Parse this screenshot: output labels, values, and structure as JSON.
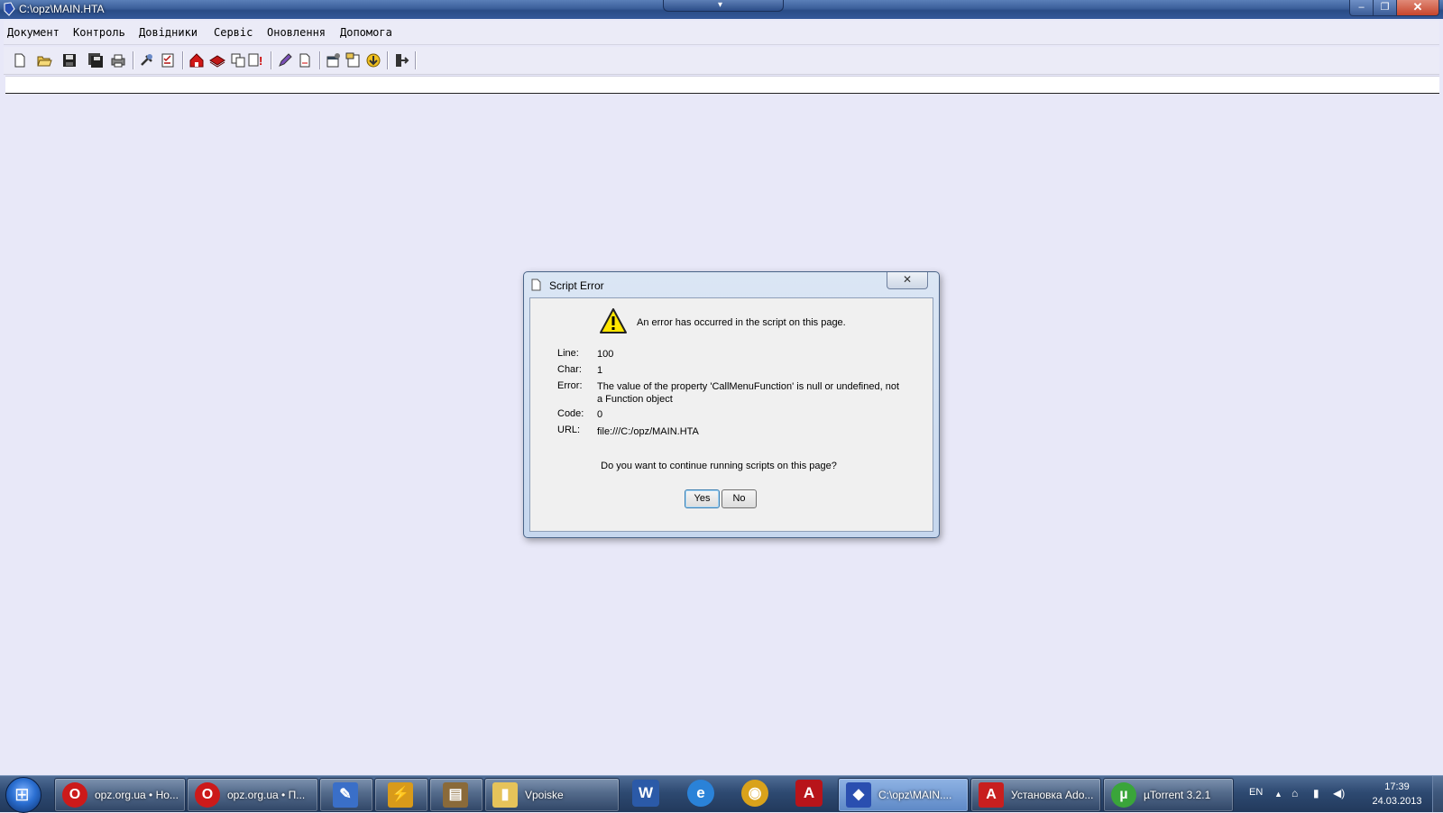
{
  "window": {
    "title": "C:\\opz\\MAIN.HTA",
    "min_label": "–",
    "max_label": "❐",
    "close_label": "✕",
    "collapse_label": "▾"
  },
  "menu": {
    "items": [
      "Документ",
      "Контроль",
      "Довідники",
      "Сервіс",
      "Оновлення",
      "Допомога"
    ]
  },
  "toolbar": {
    "icons": [
      "new-document-icon",
      "open-folder-icon",
      "save-icon",
      "save-all-icon",
      "print-icon",
      "tools-icon",
      "check-list-icon",
      "home-icon",
      "book-icon",
      "copy-icon",
      "alert-list-icon",
      "edit-pen-icon",
      "document-page-icon",
      "settings-window-icon",
      "report-icon",
      "download-icon",
      "exit-icon"
    ]
  },
  "dialog": {
    "title": "Script Error",
    "close_label": "✕",
    "message": "An error has occurred in the script on this page.",
    "fields": [
      {
        "label": "Line:",
        "value": "100"
      },
      {
        "label": "Char:",
        "value": "1"
      },
      {
        "label": "Error:",
        "value": "The value of the property 'CallMenuFunction' is null or undefined, not a Function object"
      },
      {
        "label": "Code:",
        "value": "0"
      },
      {
        "label": "URL:",
        "value": "file:///C:/opz/MAIN.HTA"
      }
    ],
    "question": "Do you want to continue running scripts on this page?",
    "yes_label": "Yes",
    "no_label": "No"
  },
  "taskbar": {
    "start_glyph": "⊞",
    "tasks": [
      {
        "label": "opz.org.ua • Но...",
        "icon": "opera-icon",
        "color": "#cc1a1a",
        "glyph": "O"
      },
      {
        "label": "opz.org.ua • П...",
        "icon": "opera-icon",
        "color": "#cc1a1a",
        "glyph": "O"
      },
      {
        "label": "",
        "icon": "app-icon-1",
        "color": "#3a6fc8",
        "glyph": "✎"
      },
      {
        "label": "",
        "icon": "app-icon-2",
        "color": "#d89a1a",
        "glyph": "⚡"
      },
      {
        "label": "",
        "icon": "archive-icon",
        "color": "#8a6a3a",
        "glyph": "▤"
      },
      {
        "label": "Vpoiske",
        "icon": "folder-icon",
        "color": "#e6c35a",
        "glyph": "▮"
      },
      {
        "label": "C:\\opz\\MAIN....",
        "icon": "hta-icon",
        "color": "#2a4fb0",
        "glyph": "◆"
      },
      {
        "label": "Установка Ado...",
        "icon": "adobe-icon",
        "color": "#c81f1f",
        "glyph": "A"
      },
      {
        "label": "µTorrent 3.2.1",
        "icon": "utorrent-icon",
        "color": "#3aa53a",
        "glyph": "µ"
      }
    ],
    "pinned": [
      {
        "icon": "word-icon",
        "color": "#2b5aa8",
        "glyph": "W"
      },
      {
        "icon": "ie-icon",
        "color": "#2a82d8",
        "glyph": "e"
      },
      {
        "icon": "chrome-icon",
        "color": "#d9a21b",
        "glyph": "◉"
      },
      {
        "icon": "acrobat-icon",
        "color": "#b8141a",
        "glyph": "A"
      }
    ],
    "lang": "EN",
    "tray_icons": [
      "▲",
      "⌂",
      "▮",
      "◀)"
    ],
    "time": "17:39",
    "date": "24.03.2013"
  }
}
